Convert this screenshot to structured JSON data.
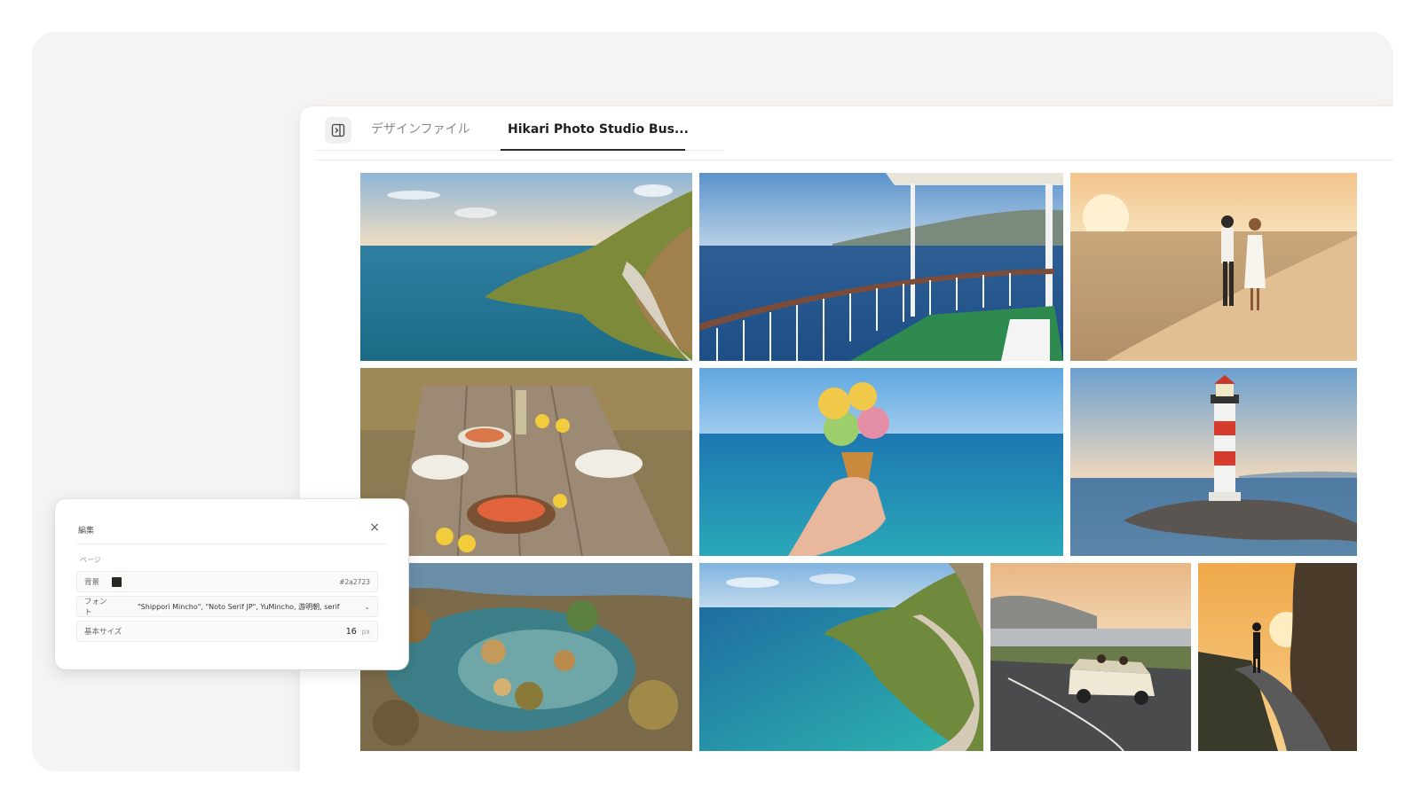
{
  "window": {
    "tabs": [
      {
        "label": "デザインファイル",
        "active": false
      },
      {
        "label": "Hikari Photo Studio Bus...",
        "active": true
      }
    ]
  },
  "gallery": {
    "photos": [
      {
        "subject": "coastal cliff with winding road"
      },
      {
        "subject": "ferry deck over open sea"
      },
      {
        "subject": "couple walking on beach at sunset"
      },
      {
        "subject": "seafood lunch on wooden table"
      },
      {
        "subject": "ice cream cone held over sea"
      },
      {
        "subject": "red and white lighthouse"
      },
      {
        "subject": "rocky tide pool"
      },
      {
        "subject": "winding coastal road and bay"
      },
      {
        "subject": "vintage convertible on road at dusk"
      },
      {
        "subject": "silhouette walking at sunset"
      }
    ]
  },
  "edit_panel": {
    "title": "編集",
    "close_symbol": "×",
    "section": "ページ",
    "rows": {
      "background": {
        "label": "背景",
        "color": "#2a2723",
        "value": "#2a2723"
      },
      "font": {
        "label": "フォント",
        "value": "\"Shippori Mincho\", \"Noto Serif JP\", YuMincho, 游明朝, serif"
      },
      "base_size": {
        "label": "基本サイズ",
        "value": "16",
        "unit": "px"
      }
    }
  },
  "icons": {
    "sidebar_toggle": "sidebar-toggle-icon",
    "select_chevron": "chevron-down-icon"
  }
}
